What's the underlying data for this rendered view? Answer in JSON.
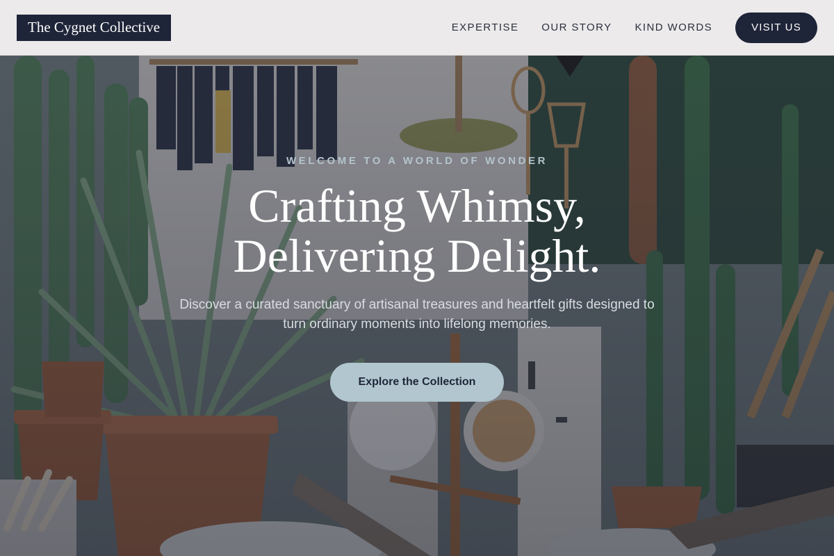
{
  "header": {
    "logo_text": "The Cygnet Collective",
    "nav": [
      {
        "label": "EXPERTISE"
      },
      {
        "label": "OUR STORY"
      },
      {
        "label": "KIND WORDS"
      }
    ],
    "cta_label": "VISIT US"
  },
  "hero": {
    "eyebrow": "WELCOME TO A WORLD OF WONDER",
    "headline_line1": "Crafting Whimsy,",
    "headline_line2": "Delivering Delight.",
    "subtext": "Discover a curated sanctuary of artisanal treasures and heartfelt gifts designed to turn ordinary moments into lifelong memories.",
    "cta_label": "Explore the Collection",
    "background_image": "shop-interior-plants-photo"
  },
  "colors": {
    "brand_dark": "#1e2538",
    "accent_light": "#b1c6ce",
    "header_bg": "#f2f0f0"
  }
}
